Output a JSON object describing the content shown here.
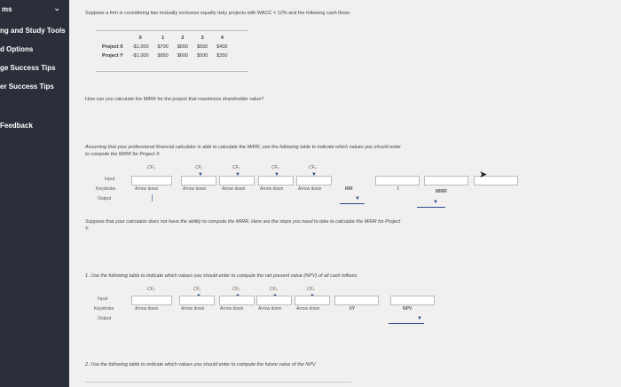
{
  "sidebar": {
    "top_label": "ms",
    "items": [
      "ng and Study Tools",
      "d Options",
      "ge Success Tips",
      "er Success Tips",
      "Feedback"
    ]
  },
  "intro": "Suppose a firm is considering two mutually exclusive equally risky projects with WACC = 12% and the following cash flows:",
  "cashflow": {
    "years": [
      "0",
      "1",
      "2",
      "3",
      "4"
    ],
    "rows": [
      {
        "name": "Project X",
        "values": [
          "-$1,000",
          "$700",
          "$650",
          "$550",
          "$400"
        ]
      },
      {
        "name": "Project Y",
        "values": [
          "-$1,000",
          "$950",
          "$600",
          "$500",
          "$350"
        ]
      }
    ]
  },
  "question": "How can you calculate the MIRR for the project that maximizes shareholder value?",
  "part_a": {
    "text1": "Assuming that your professional financial calculator is able to calculate the MIRR, use the following table to indicate which values you should enter",
    "text2": "to compute the MIRR for Project X.",
    "headers": [
      "CF₀",
      "CF₁",
      "CF₂",
      "CF₃",
      "CF₄"
    ],
    "row_labels": [
      "Input",
      "Keystroke",
      "Output"
    ],
    "keystrokes": [
      "Arrow down",
      "Arrow down",
      "Arrow down",
      "Arrow down",
      "Arrow down"
    ],
    "irr": "IRR",
    "i": "I",
    "mirr": "MIRR"
  },
  "part_b": {
    "text1": "Suppose that your calculator does not have the ability to compute the MIRR. Here are the steps you need to take to calculate the MIRR for Project",
    "text2": "Y."
  },
  "step1": {
    "text": "1. Use the following table to indicate which values you should enter to compute the net present value (NPV) of all cash inflows.",
    "headers": [
      "CF₀",
      "CF₁",
      "CF₂",
      "CF₃",
      "CF₄"
    ],
    "row_labels": [
      "Input",
      "Keystroke",
      "Output"
    ],
    "keystrokes": [
      "Arrow down",
      "Arrow down",
      "Arrow down",
      "Arrow down",
      "Arrow down"
    ],
    "iy": "I/Y",
    "npv": "NPV"
  },
  "step2": {
    "text": "2. Use the following table to indicate which values you should enter to compute the future value of the NPV."
  },
  "colors": {
    "sidebar": "#2a2f3a",
    "link": "#2a4b8d"
  }
}
